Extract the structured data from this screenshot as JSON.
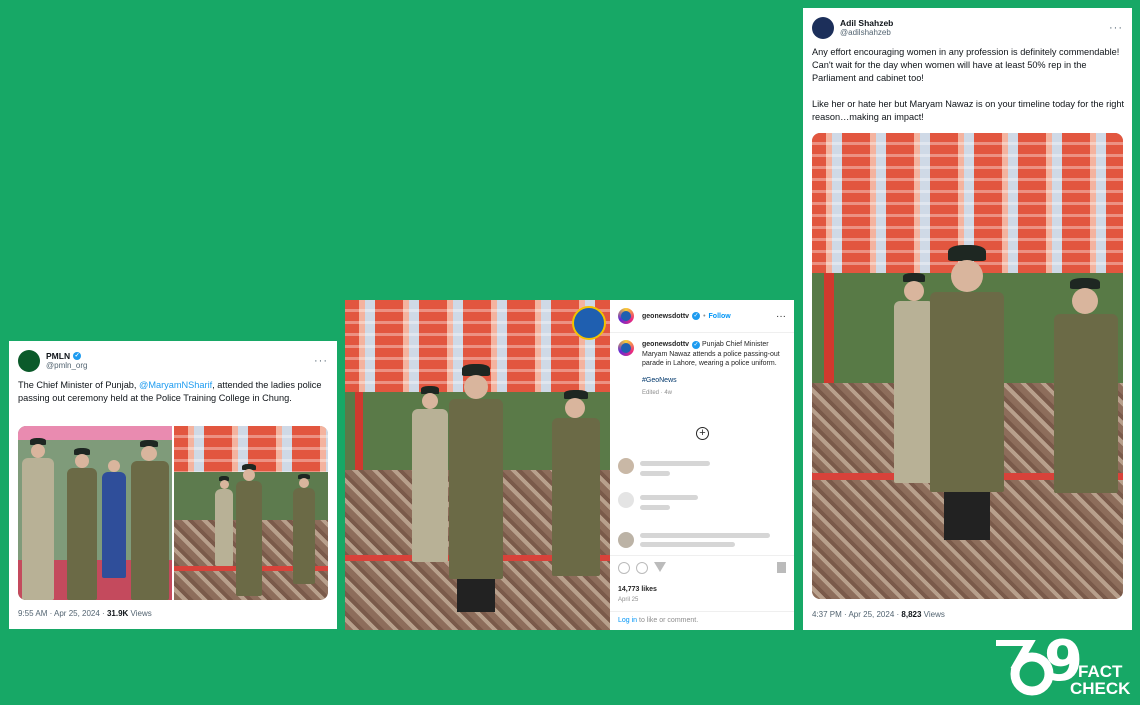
{
  "pmln_post": {
    "name": "PMLN",
    "handle": "@pmln_org",
    "text_before": "The Chief Minister of Punjab, ",
    "mention": "@MaryamNSharif",
    "text_after": ", attended the ladies police passing out ceremony held at the Police Training College in Chung.",
    "time": "9:55 AM · Apr 25, 2024 · ",
    "views_count": "31.9K",
    "views_label": " Views",
    "more": "···"
  },
  "instagram_post": {
    "username": "geonewsdottv",
    "follow": "Follow",
    "caption_user": "geonewsdottv",
    "caption": "Punjab Chief Minister Maryam Nawaz attends a police passing-out parade in Lahore, wearing a police uniform.",
    "hashtag": "#GeoNews",
    "edited": "Edited · 4w",
    "likes": "14,773 likes",
    "date": "April 25",
    "login_link": "Log in",
    "login_text": " to like or comment.",
    "more": "···"
  },
  "adil_post": {
    "name": "Adil Shahzeb",
    "handle": "@adilshahzeb",
    "paragraph1": "Any effort encouraging women in any profession is definitely commendable! Can't wait for the day when women will have at least 50% rep in the Parliament and cabinet too!",
    "paragraph2": "Like her or hate her but Maryam Nawaz is on your timeline today for the right reason…making an impact!",
    "time": "4:37 PM · Apr 25, 2024 · ",
    "views_count": "8,823",
    "views_label": " Views",
    "more": "···"
  },
  "logo": {
    "number": "9",
    "line1": "FACT",
    "line2": "CHECK"
  },
  "colors": {
    "background": "#17a866",
    "link": "#1d9bf0",
    "canopy": "#e2563f"
  }
}
